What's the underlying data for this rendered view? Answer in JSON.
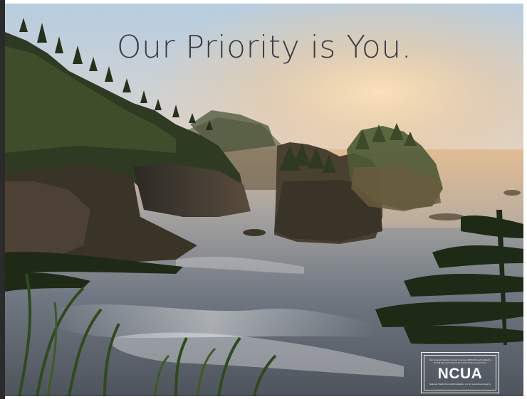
{
  "headline": "Our Priority is You.",
  "ncua_badge": {
    "logo": "NCUA",
    "fine_print_top": "Your savings federally insured to at least $250,000 and backed by the full faith and credit of the United States Government",
    "fine_print_bottom": "National Credit Union Administration, a U.S. Government Agency"
  },
  "colors": {
    "headline_text": "#3a3e43",
    "sky_top": "#b9cfe0",
    "sky_glow": "#f4d2a8",
    "sea": "#8f9aa6"
  }
}
